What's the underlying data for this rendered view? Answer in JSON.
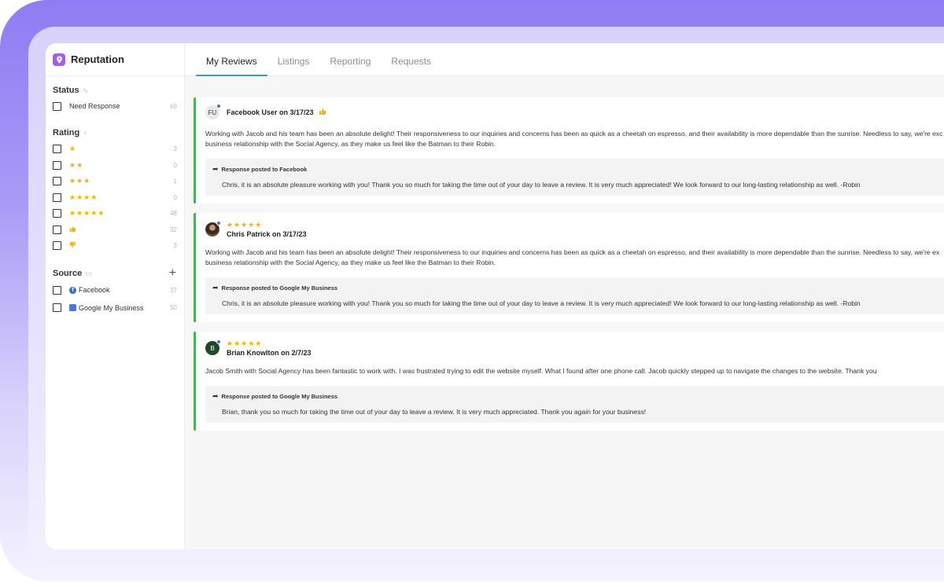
{
  "app": {
    "title": "Reputation"
  },
  "tabs": [
    {
      "label": "My Reviews",
      "active": true
    },
    {
      "label": "Listings",
      "active": false
    },
    {
      "label": "Reporting",
      "active": false
    },
    {
      "label": "Requests",
      "active": false
    }
  ],
  "sidebar": {
    "status": {
      "title": "Status",
      "items": [
        {
          "label": "Need Response",
          "count": "69"
        }
      ]
    },
    "rating": {
      "title": "Rating",
      "items": [
        {
          "stars": "★",
          "count": "3"
        },
        {
          "stars": "★★",
          "count": "0"
        },
        {
          "stars": "★★★",
          "count": "1"
        },
        {
          "stars": "★★★★",
          "count": "0"
        },
        {
          "stars": "★★★★★",
          "count": "48"
        },
        {
          "icon": "thumbs-up-icon",
          "count": "32"
        },
        {
          "icon": "thumbs-down-icon",
          "count": "3"
        }
      ]
    },
    "source": {
      "title": "Source",
      "items": [
        {
          "label": "Facebook",
          "icon": "facebook-icon",
          "count": "37"
        },
        {
          "label": "Google My Business",
          "icon": "google-my-business-icon",
          "count": "50"
        }
      ]
    }
  },
  "reviews": [
    {
      "initials": "FU",
      "reviewer": "Facebook User on 3/17/23",
      "rating_type": "recommendation",
      "text_line1": "Working with Jacob and his team has been an absolute delight! Their responsiveness to our inquiries and concerns has been as quick as a cheetah on espresso, and their availability is more dependable than the sunrise. Needless to say, we're exc",
      "text_line2": "business relationship with the Social Agency, as they make us feel like the Batman to their Robin.",
      "response_label": "Response posted to Facebook",
      "response_text": "Chris, it is an absolute pleasure working with you! Thank you so much for taking the time out of your day to leave a review. It is very much appreciated! We look forward to our long-lasting relationship as well. -Robin"
    },
    {
      "initials": "",
      "reviewer": "Chris Patrick on 3/17/23",
      "stars": "★★★★★",
      "text_line1": "Working with Jacob and his team has been an absolute delight! Their responsiveness to our inquiries and concerns has been as quick as a cheetah on espresso, and their availability is more dependable than the sunrise. Needless to say, we're ex",
      "text_line2": "business relationship with the Social Agency, as they make us feel like the Batman to their Robin.",
      "response_label": "Response posted to Google My Business",
      "response_text": "Chris, it is an absolute pleasure working with you! Thank you so much for taking the time out of your day to leave a review. It is very much appreciated! We look forward to our long-lasting relationship as well. -Robin"
    },
    {
      "initials": "B",
      "reviewer": "Brian Knowlton on 2/7/23",
      "stars": "★★★★★",
      "text_line1": "Jacob Smith with Social Agency has been fantastic to work with. I was frustrated trying to edit the website myself. What I found after one phone call. Jacob quickly stepped up to navigate the changes to the website. Thank you",
      "text_line2": "",
      "response_label": "Response posted to Google My Business",
      "response_text": "Brian, thank you so much for taking the time out of your day to leave a review. It is very much appreciated. Thank you again for your business!"
    }
  ],
  "colors": {
    "accent_tab": "#3b9bd8",
    "star": "#f2b400",
    "review_border": "#4caf50",
    "brand_icon": "#a65de8"
  }
}
